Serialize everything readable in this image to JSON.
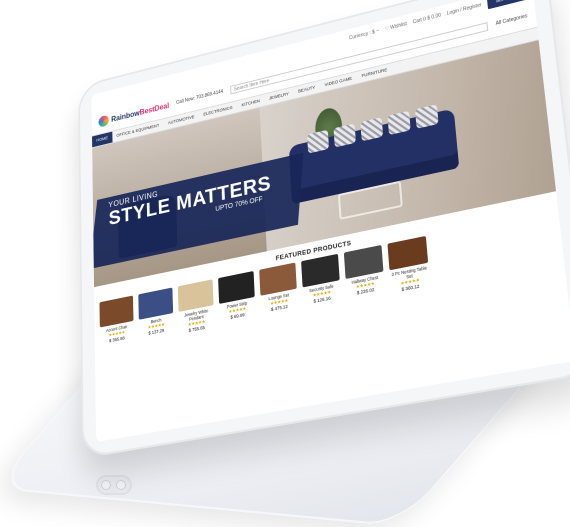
{
  "store": {
    "logo_a": "Rainbow",
    "logo_b": "BestDeal",
    "call": "Call Now: 703.869.4144",
    "search_placeholder": "Search Item Here",
    "topbar": {
      "currency": "Currency : $ ~",
      "wishlist": "♡ Wishlist",
      "cart": "Cart 0 $ 0.00",
      "login": "Login / Register",
      "search_button": "SEARCH",
      "all_categories": "All Categories"
    },
    "nav": [
      "HOME",
      "OFFICE & EQUIPMENT",
      "AUTOMOTIVE",
      "ELECTRONICS",
      "KITCHEN",
      "JEWELRY",
      "BEAUTY",
      "VIDEO GAME",
      "FURNITURE"
    ],
    "hero": {
      "line1": "YOUR LIVING",
      "line2": "STYLE MATTERS",
      "line3": "UPTO 70% OFF"
    },
    "featured_title": "FEATURED PRODUCTS",
    "products": [
      {
        "name": "Accent Chair",
        "price": "$ 355.88",
        "color": "#7b4a2a"
      },
      {
        "name": "Bench",
        "price": "$ 137.29",
        "color": "#3b4f86"
      },
      {
        "name": "Jewelry White Pendant",
        "price": "$ 755.65",
        "color": "#d8c39a"
      },
      {
        "name": "Power Strip",
        "price": "$ 69.99",
        "color": "#222222"
      },
      {
        "name": "Lounge Set",
        "price": "$ 475.12",
        "color": "#8a5a3a"
      },
      {
        "name": "Security Safe",
        "price": "$ 126.16",
        "color": "#2a2a2a"
      },
      {
        "name": "Hallway Chest",
        "price": "$ 226.02",
        "color": "#4a4a4a"
      },
      {
        "name": "3 Pc Nesting Table Set",
        "price": "$ 360.12",
        "color": "#6b3b20"
      }
    ],
    "stars": "★★★★★"
  }
}
